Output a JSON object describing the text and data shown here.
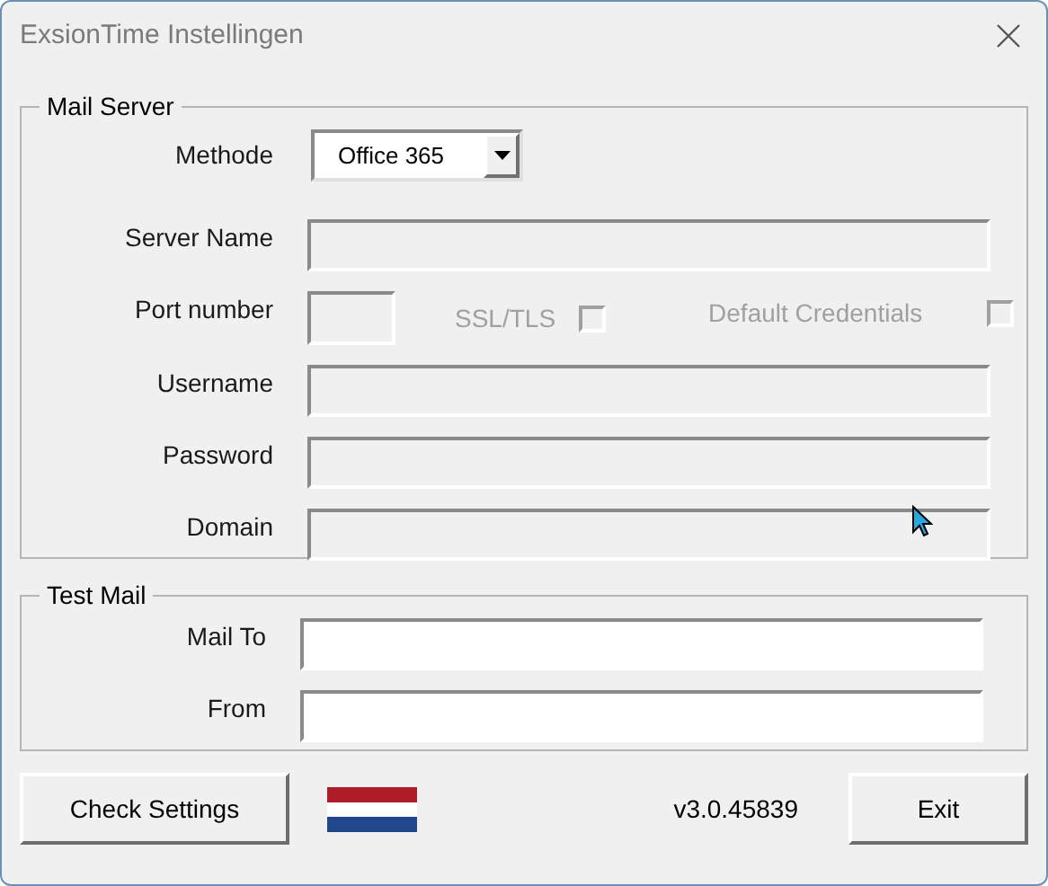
{
  "window": {
    "title": "ExsionTime Instellingen"
  },
  "mail_server": {
    "legend": "Mail Server",
    "method": {
      "label": "Methode",
      "value": "Office 365"
    },
    "server_name": {
      "label": "Server Name",
      "disabled": true
    },
    "port": {
      "label": "Port number",
      "disabled": true
    },
    "checkboxes": [
      {
        "label": "SSL/TLS",
        "checked": false,
        "disabled": true
      },
      {
        "label": "Default Credentials",
        "checked": false,
        "disabled": true
      }
    ],
    "fields": [
      {
        "label": "Username",
        "disabled": true
      },
      {
        "label": "Password",
        "disabled": true
      },
      {
        "label": "Domain",
        "disabled": true
      }
    ]
  },
  "test_mail": {
    "legend": "Test Mail",
    "fields": [
      {
        "label": "Mail To",
        "disabled": false
      },
      {
        "label": "From",
        "disabled": false
      }
    ]
  },
  "footer": {
    "check_button": "Check Settings",
    "version": "v3.0.45839",
    "exit_button": "Exit"
  }
}
